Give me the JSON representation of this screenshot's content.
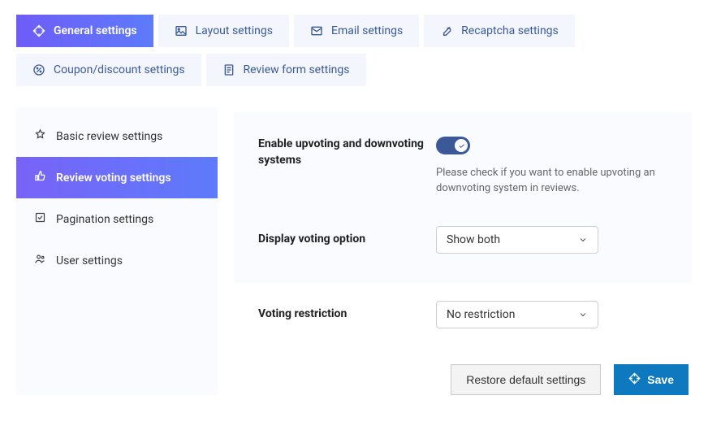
{
  "tabs": {
    "general": {
      "label": "General settings"
    },
    "layout": {
      "label": "Layout settings"
    },
    "email": {
      "label": "Email settings"
    },
    "recaptcha": {
      "label": "Recaptcha settings"
    },
    "coupon": {
      "label": "Coupon/discount settings"
    },
    "review_form": {
      "label": "Review form settings"
    }
  },
  "sidebar": {
    "basic": {
      "label": "Basic review settings"
    },
    "voting": {
      "label": "Review voting settings"
    },
    "pagination": {
      "label": "Pagination settings"
    },
    "user": {
      "label": "User settings"
    }
  },
  "fields": {
    "enable_voting": {
      "label": "Enable upvoting and downvoting systems",
      "help": "Please check if you want to enable upvoting an downvoting system in reviews.",
      "value": true
    },
    "display_option": {
      "label": "Display voting option",
      "value": "Show both"
    },
    "voting_restriction": {
      "label": "Voting restriction",
      "value": "No restriction"
    }
  },
  "footer": {
    "restore": "Restore default settings",
    "save": "Save"
  }
}
